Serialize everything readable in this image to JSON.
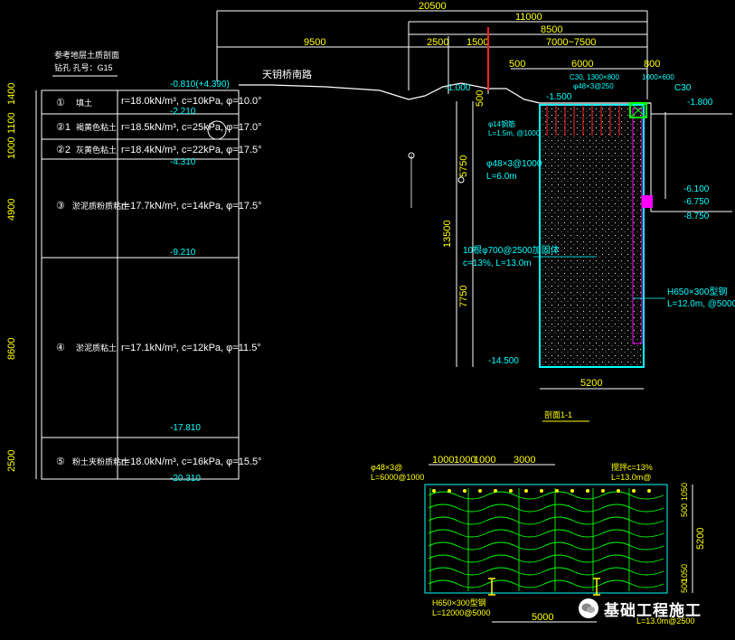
{
  "borehole": {
    "title": "参考地层土质剖面",
    "subtitle": "钻孔 孔号：G15"
  },
  "top_dims": [
    "20500",
    "11000",
    "9500",
    "2500",
    "1500",
    "8500",
    "7000~7500",
    "500",
    "6000",
    "800"
  ],
  "road_label": "天钥桥南路",
  "levels": [
    "-0.810(+4.390)",
    "-2.210",
    "-3.510",
    "-4.310",
    "-9.210",
    "-17.810",
    "-20.310",
    "-1.000",
    "-1.500",
    "-1.800",
    "-6.100",
    "-6.750",
    "-8.750",
    "-14.500"
  ],
  "left_dims": [
    "1400",
    "1100",
    "1000",
    "4900",
    "8600",
    "2500"
  ],
  "layers": [
    {
      "no": "①",
      "name": "填土",
      "props": "r=18.0kN/m³, c=10kPa, φ=10.0°"
    },
    {
      "no": "②1",
      "name": "褐黄色粘土",
      "props": "r=18.5kN/m³, c=25kPa, φ=17.0°"
    },
    {
      "no": "②2",
      "name": "灰黄色粘土",
      "props": "r=18.4kN/m³, c=22kPa, φ=17.5°"
    },
    {
      "no": "③",
      "name": "淤泥质粉质粘土",
      "props": "r=17.7kN/m³, c=14kPa, φ=17.5°"
    },
    {
      "no": "④",
      "name": "淤泥质粘土",
      "props": "r=17.1kN/m³, c=12kPa, φ=11.5°"
    },
    {
      "no": "⑤",
      "name": "粉土夹粉质粘土",
      "props": "r=18.0kN/m³, c=16kPa, φ=15.5°"
    }
  ],
  "section": {
    "cap_beam": "C30, 1300×800",
    "cap_beam_sub": "φ48×3@250",
    "top_beam": "1000×600",
    "top_beam_sub": "C30",
    "nail_upper": "φ48×3@1000",
    "nail_upper_len": "L=6.0m",
    "nail_top": "φ14钢筋",
    "nail_top_len": "L=1.5m, @1000",
    "mixing_pile": "10根φ700@2500加固体",
    "mixing_pile_cement": "c=13%, L=13.0m",
    "steel_h": "H650×300型钢",
    "steel_h_len": "L=12.0m, @5000",
    "dims_v": [
      "5750",
      "13500",
      "7750",
      "500"
    ],
    "width": "5200",
    "title": "剖面1-1"
  },
  "plan": {
    "nail_label": "φ48×3@",
    "nail_len": "L=6000@1000",
    "cement_label": "搅拌c=13%",
    "cement_len": "L=13.0m@",
    "top_dims": [
      "1000",
      "1000",
      "1000",
      "3000"
    ],
    "right_dims": [
      "1050",
      "500",
      "5200",
      "1050",
      "500"
    ],
    "h_label": "H650×300型钢",
    "h_len": "L=12000@5000",
    "bottom_right": "L=13.0m@2500",
    "bottom_dim": "5000"
  },
  "watermark": "基础工程施工",
  "colors": {
    "yellow": "#ffff00",
    "cyan": "#00ffff",
    "white": "#ffffff",
    "green": "#00ff00",
    "magenta": "#ff00ff",
    "red": "#ff2020"
  }
}
